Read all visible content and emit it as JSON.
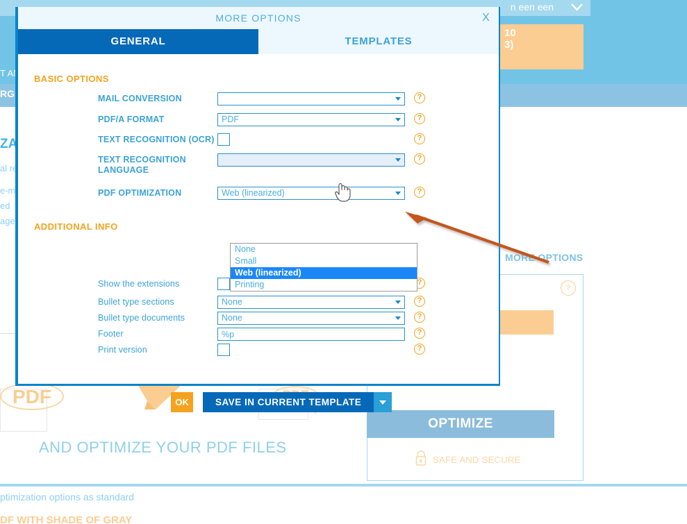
{
  "background": {
    "topbar_text": "n een een",
    "chevron_icon": "chevron-down-icon",
    "orange_box_line1": "10",
    "orange_box_line2": "3)",
    "left_fragments": {
      "ant": "T AN",
      "rgi": "RGI",
      "za": "ZA",
      "l1": "al re",
      "l2": "e-m",
      "l3": "ed",
      "l4": "age"
    },
    "more_options_link": "MORE OPTIONS",
    "panel_help": "?",
    "orange_box2_text": ")",
    "optimize_button": "OPTIMIZE",
    "safe_and_secure": "SAFE AND SECURE",
    "lock_icon": "lock-icon",
    "pdf_badge_1": "PDF",
    "pdf_badge_2": "PDF",
    "tagline": "AND OPTIMIZE YOUR PDF FILES",
    "bottom_line_1": "ptimization options as standard",
    "bottom_line_2": "DF WITH SHADE OF GRAY"
  },
  "modal": {
    "title": "MORE OPTIONS",
    "close_label": "X",
    "tabs": [
      {
        "label": "GENERAL",
        "active": true
      },
      {
        "label": "TEMPLATES",
        "active": false
      }
    ],
    "basic_options_header": "BASIC OPTIONS",
    "additional_info_header": "ADDITIONAL INFO",
    "basic_fields": [
      {
        "label": "MAIL CONVERSION",
        "type": "select",
        "value": "",
        "help": "?"
      },
      {
        "label": "PDF/A FORMAT",
        "type": "select",
        "value": "PDF",
        "help": "?"
      },
      {
        "label": "TEXT RECOGNITION (OCR)",
        "type": "checkbox",
        "checked": false,
        "help": "?"
      },
      {
        "label": "TEXT RECOGNITION LANGUAGE",
        "type": "select",
        "value": "",
        "disabled": true,
        "help": "?"
      },
      {
        "label": "PDF OPTIMIZATION",
        "type": "select",
        "value": "Web (linearized)",
        "open": true,
        "help": "?"
      }
    ],
    "pdf_optimization_options": [
      {
        "label": "None",
        "selected": false
      },
      {
        "label": "Small",
        "selected": false
      },
      {
        "label": "Web (linearized)",
        "selected": true
      },
      {
        "label": "Printing",
        "selected": false
      }
    ],
    "additional_fields": [
      {
        "label": "Show the extensions",
        "type": "checkbox",
        "checked": false,
        "help": "?"
      },
      {
        "label": "Bullet type sections",
        "type": "select",
        "value": "None",
        "help": "?"
      },
      {
        "label": "Bullet type documents",
        "type": "select",
        "value": "None",
        "help": "?"
      },
      {
        "label": "Footer",
        "type": "text",
        "value": "%p",
        "help": "?"
      },
      {
        "label": "Print version",
        "type": "checkbox",
        "checked": false,
        "help": "?"
      }
    ],
    "buttons": {
      "ok": "OK",
      "save": "SAVE IN CURRENT TEMPLATE",
      "save_dropdown_icon": "chevron-down-icon"
    }
  },
  "colors": {
    "accent_blue": "#0569b8",
    "light_blue": "#4aafe0",
    "orange": "#f5a21e",
    "highlight_blue": "#1b87f7",
    "annotation_orange": "#c4561b",
    "panel_bg": "#72c4e6"
  }
}
